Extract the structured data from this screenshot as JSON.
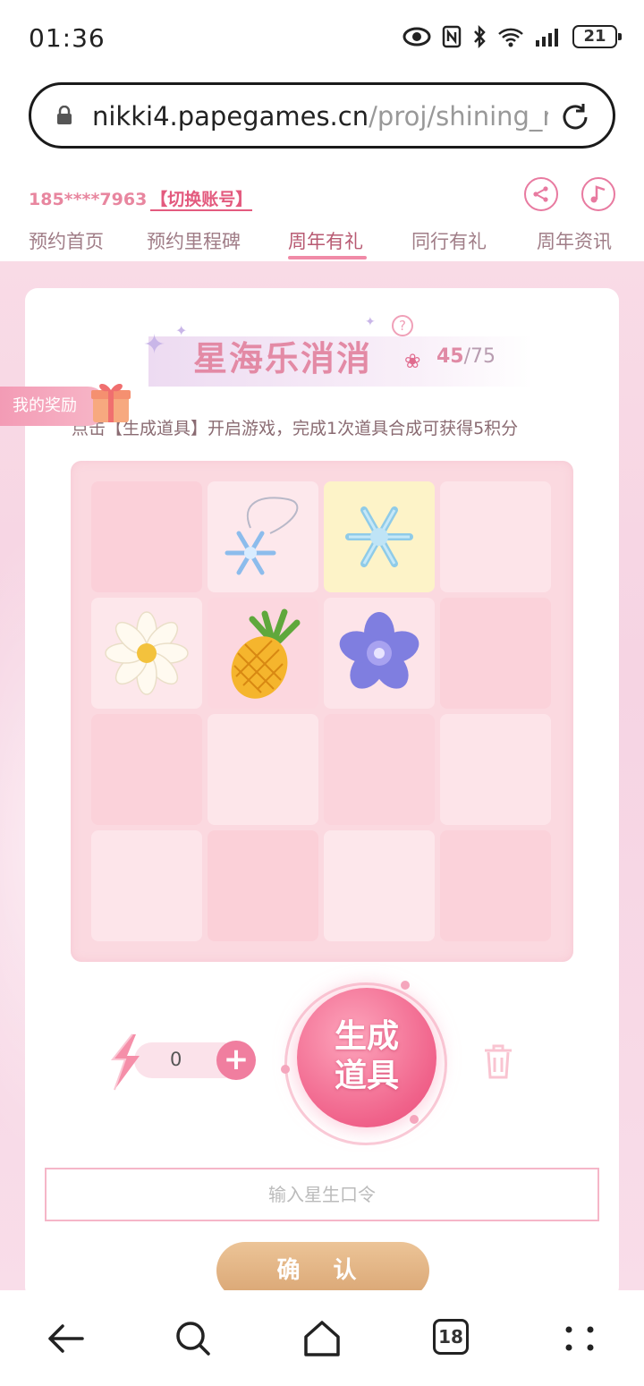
{
  "status_bar": {
    "time": "01:36",
    "battery": "21",
    "icons": [
      "eye-icon",
      "nfc-icon",
      "bluetooth-icon",
      "wifi-icon",
      "signal-icon"
    ]
  },
  "browser": {
    "url_domain": "nikki4.papegames.cn",
    "url_path": "/proj/shining_n",
    "tab_count": "18"
  },
  "header": {
    "account": "185****7963",
    "switch_label": "【切换账号】",
    "nav_tabs": [
      {
        "label": "预约首页"
      },
      {
        "label": "预约里程碑"
      },
      {
        "label": "周年有礼",
        "active": true
      },
      {
        "label": "同行有礼"
      },
      {
        "label": "周年资讯"
      }
    ]
  },
  "game": {
    "title": "星海乐消消",
    "score_current": "45",
    "score_separator": "/",
    "score_total": "75",
    "reward_label": "我的奖励",
    "instruction": "点击【生成道具】开启游戏，完成1次道具合成可获得5积分",
    "board": [
      [
        "",
        "snowflake-necklace",
        "snowflake",
        ""
      ],
      [
        "daisy",
        "pineapple",
        "purple-flower",
        ""
      ],
      [
        "",
        "",
        "",
        ""
      ],
      [
        "",
        "",
        "",
        ""
      ]
    ],
    "energy": "0",
    "generate_label_line1": "生成",
    "generate_label_line2": "道具",
    "code_placeholder": "输入星生口令",
    "confirm_label": "确 认"
  },
  "colors": {
    "accent_pink": "#f07e9f",
    "title_pink": "#e38aa5",
    "confirm_gold": "#d9a573"
  }
}
